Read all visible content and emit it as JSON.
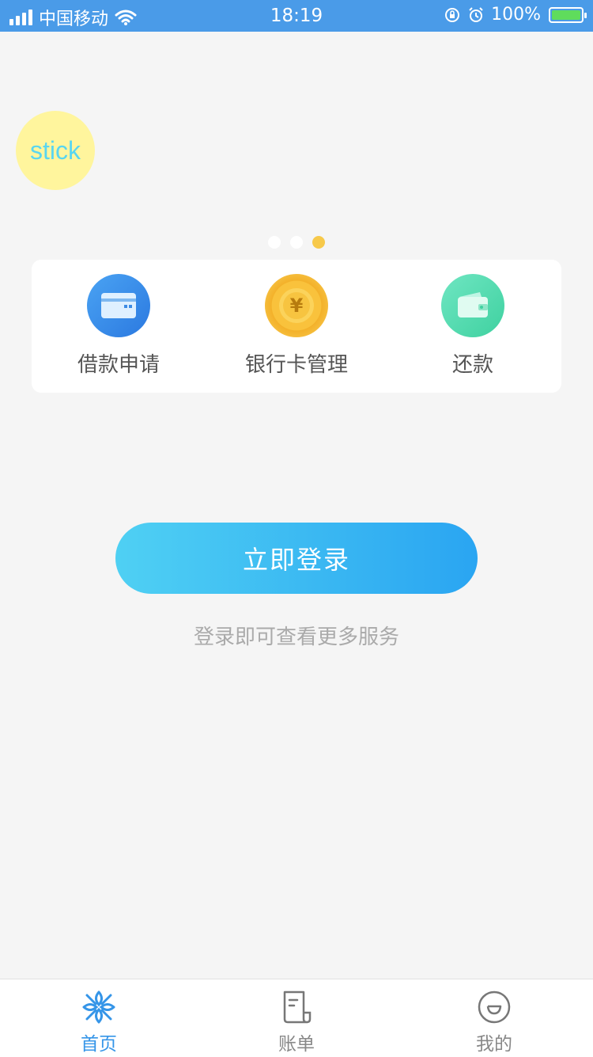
{
  "status_bar": {
    "carrier": "中国移动",
    "time": "18:19",
    "battery": "100%"
  },
  "sticker": {
    "text": "stick"
  },
  "carousel": {
    "page_count": 3,
    "active_index": 2
  },
  "quick_menu": {
    "items": [
      {
        "label": "借款申请",
        "icon": "card-icon"
      },
      {
        "label": "银行卡管理",
        "icon": "yen-coin-icon"
      },
      {
        "label": "还款",
        "icon": "wallet-icon"
      }
    ]
  },
  "login": {
    "button_label": "立即登录",
    "hint": "登录即可查看更多服务"
  },
  "tab_bar": {
    "tabs": [
      {
        "label": "首页",
        "icon": "home-snowflake-icon",
        "active": true
      },
      {
        "label": "账单",
        "icon": "bill-icon",
        "active": false
      },
      {
        "label": "我的",
        "icon": "smile-face-icon",
        "active": false
      }
    ]
  },
  "colors": {
    "status_bar": "#4a9be8",
    "accent": "#3595e8",
    "carousel_active_dot": "#f7c94a"
  }
}
